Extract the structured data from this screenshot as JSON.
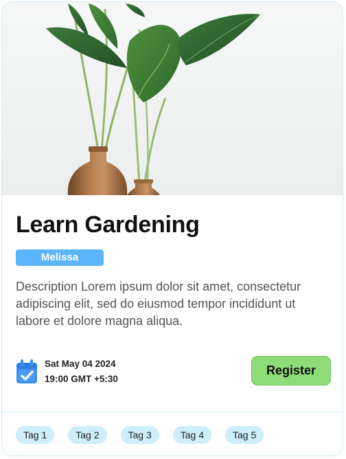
{
  "card": {
    "image": {
      "name": "plant-photo",
      "description_icon": "potted-plant-image"
    },
    "title": "Learn Gardening",
    "host_badge": "Melissa",
    "description": "Description Lorem ipsum dolor sit amet, consectetur adipiscing elit, sed do eiusmod tempor incididunt ut labore et dolore magna aliqua.",
    "event": {
      "icon": "calendar-check-icon",
      "date": "Sat May 04 2024",
      "time": "19:00 GMT +5:30"
    },
    "register_label": "Register",
    "tags": [
      "Tag 1",
      "Tag 2",
      "Tag 3",
      "Tag 4",
      "Tag 5"
    ]
  },
  "colors": {
    "badge": "#5cb5fb",
    "register_button": "#8edc78",
    "tag_background": "#cdeefa",
    "card_border": "#cfeef8",
    "calendar_icon": "#3a8ff0"
  }
}
